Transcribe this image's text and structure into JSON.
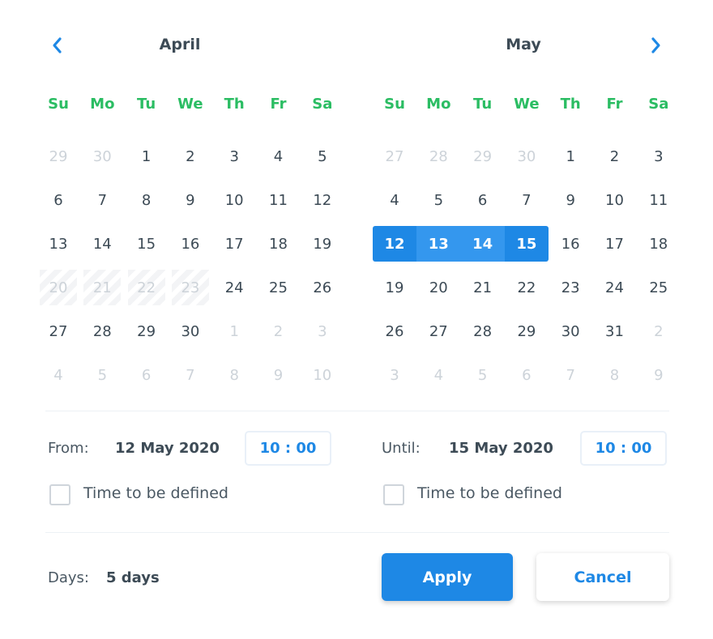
{
  "colors": {
    "accent": "#1e88e5",
    "range_mid": "#3497ee",
    "weekday": "#2bbd63",
    "text": "#3c4a55",
    "muted": "#cdd3d9"
  },
  "navigation": {
    "prev_icon": "chevron-left-icon",
    "next_icon": "chevron-right-icon"
  },
  "weekdays": [
    "Su",
    "Mo",
    "Tu",
    "We",
    "Th",
    "Fr",
    "Sa"
  ],
  "calendars": [
    {
      "month": "April",
      "weeks": [
        [
          {
            "d": "29",
            "s": "other"
          },
          {
            "d": "30",
            "s": "other"
          },
          {
            "d": "1"
          },
          {
            "d": "2"
          },
          {
            "d": "3"
          },
          {
            "d": "4"
          },
          {
            "d": "5"
          }
        ],
        [
          {
            "d": "6"
          },
          {
            "d": "7"
          },
          {
            "d": "8"
          },
          {
            "d": "9"
          },
          {
            "d": "10"
          },
          {
            "d": "11"
          },
          {
            "d": "12"
          }
        ],
        [
          {
            "d": "13"
          },
          {
            "d": "14"
          },
          {
            "d": "15"
          },
          {
            "d": "16"
          },
          {
            "d": "17"
          },
          {
            "d": "18"
          },
          {
            "d": "19"
          }
        ],
        [
          {
            "d": "20",
            "s": "disabled"
          },
          {
            "d": "21",
            "s": "disabled"
          },
          {
            "d": "22",
            "s": "disabled"
          },
          {
            "d": "23",
            "s": "disabled"
          },
          {
            "d": "24"
          },
          {
            "d": "25"
          },
          {
            "d": "26"
          }
        ],
        [
          {
            "d": "27"
          },
          {
            "d": "28"
          },
          {
            "d": "29"
          },
          {
            "d": "30"
          },
          {
            "d": "1",
            "s": "other"
          },
          {
            "d": "2",
            "s": "other"
          },
          {
            "d": "3",
            "s": "other"
          }
        ],
        [
          {
            "d": "4",
            "s": "other"
          },
          {
            "d": "5",
            "s": "other"
          },
          {
            "d": "6",
            "s": "other"
          },
          {
            "d": "7",
            "s": "other"
          },
          {
            "d": "8",
            "s": "other"
          },
          {
            "d": "9",
            "s": "other"
          },
          {
            "d": "10",
            "s": "other"
          }
        ]
      ]
    },
    {
      "month": "May",
      "weeks": [
        [
          {
            "d": "27",
            "s": "other"
          },
          {
            "d": "28",
            "s": "other"
          },
          {
            "d": "29",
            "s": "other"
          },
          {
            "d": "30",
            "s": "other"
          },
          {
            "d": "1"
          },
          {
            "d": "2"
          },
          {
            "d": "3"
          }
        ],
        [
          {
            "d": "4"
          },
          {
            "d": "5"
          },
          {
            "d": "6"
          },
          {
            "d": "7"
          },
          {
            "d": "9"
          },
          {
            "d": "10"
          },
          {
            "d": "11"
          }
        ],
        [
          {
            "d": "12",
            "s": "sel-start"
          },
          {
            "d": "13",
            "s": "sel"
          },
          {
            "d": "14",
            "s": "sel"
          },
          {
            "d": "15",
            "s": "sel-end"
          },
          {
            "d": "16"
          },
          {
            "d": "17"
          },
          {
            "d": "18"
          }
        ],
        [
          {
            "d": "19"
          },
          {
            "d": "20"
          },
          {
            "d": "21"
          },
          {
            "d": "22"
          },
          {
            "d": "23"
          },
          {
            "d": "24"
          },
          {
            "d": "25"
          }
        ],
        [
          {
            "d": "26"
          },
          {
            "d": "27"
          },
          {
            "d": "28"
          },
          {
            "d": "29"
          },
          {
            "d": "30"
          },
          {
            "d": "31"
          },
          {
            "d": "2",
            "s": "other"
          }
        ],
        [
          {
            "d": "3",
            "s": "other"
          },
          {
            "d": "4",
            "s": "other"
          },
          {
            "d": "5",
            "s": "other"
          },
          {
            "d": "6",
            "s": "other"
          },
          {
            "d": "7",
            "s": "other"
          },
          {
            "d": "8",
            "s": "other"
          },
          {
            "d": "9",
            "s": "other"
          }
        ]
      ]
    }
  ],
  "from": {
    "label": "From:",
    "date": "12 May 2020",
    "time": "10 : 00",
    "checkbox_label": "Time to be defined",
    "checked": false
  },
  "until": {
    "label": "Until:",
    "date": "15 May 2020",
    "time": "10 : 00",
    "checkbox_label": "Time to be defined",
    "checked": false
  },
  "footer": {
    "days_label": "Days:",
    "days_value": "5 days",
    "apply_label": "Apply",
    "cancel_label": "Cancel"
  }
}
